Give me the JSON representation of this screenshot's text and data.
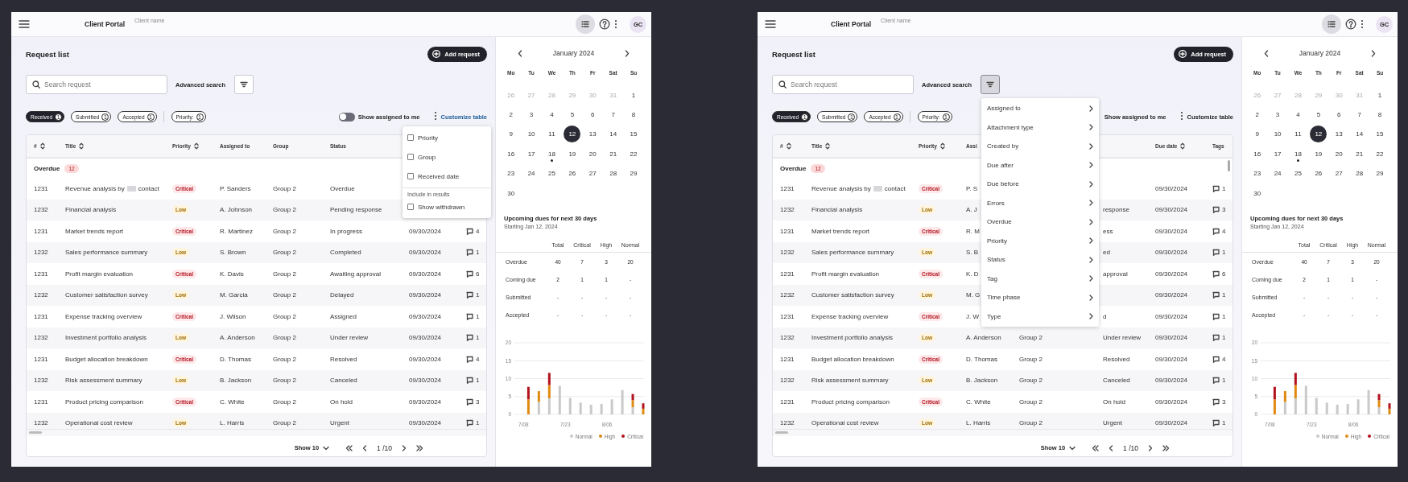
{
  "screens": [
    {
      "header": {
        "app_title": "Client Portal",
        "client_label": "Client name",
        "avatar": "GC"
      },
      "page_title": "Request list",
      "add_button": "Add request",
      "search": {
        "placeholder": "Search request"
      },
      "advanced_search": "Advanced search",
      "filter_button": {
        "active": false
      },
      "chips": [
        {
          "label": "Received",
          "count": "1",
          "selected": true
        },
        {
          "label": "Submitted",
          "count": "1",
          "selected": false
        },
        {
          "label": "Accepted",
          "count": "1",
          "selected": false
        },
        {
          "label": "Priority:",
          "count": "1",
          "selected": false
        }
      ],
      "assigned_toggle": {
        "label": "Show assigned to me",
        "on": false
      },
      "customize": {
        "label": "Customize table",
        "active": true
      },
      "table": {
        "columns": [
          {
            "label": "#",
            "sortable": true
          },
          {
            "label": "Title",
            "sortable": true
          },
          {
            "label": "Priority",
            "sortable": true
          },
          {
            "label": "Assigned to",
            "sortable": false
          },
          {
            "label": "Group",
            "sortable": false
          },
          {
            "label": "Status",
            "sortable": false
          },
          null,
          null
        ],
        "group": {
          "label": "Overdue",
          "count": "12"
        },
        "rows": [
          {
            "id": "1231",
            "title": "Revenue analysis by",
            "title_end": "contact",
            "priority": {
              "label": "Critical",
              "kind": "critical"
            },
            "assigned_to": "P. Sanders",
            "group": "Group 2",
            "status": "Overdue"
          },
          {
            "id": "1232",
            "title": "Financial analysis",
            "priority": {
              "label": "Low",
              "kind": "low"
            },
            "assigned_to": "A. Johnson",
            "group": "Group 2",
            "status": "Pending response"
          },
          {
            "id": "1231",
            "title": "Market trends report",
            "priority": {
              "label": "Critical",
              "kind": "critical"
            },
            "assigned_to": "R. Martinez",
            "group": "Group 2",
            "status": "In progress",
            "due_date": "09/30/2024",
            "tags": "4"
          },
          {
            "id": "1232",
            "title": "Sales performance summary",
            "priority": {
              "label": "Low",
              "kind": "low"
            },
            "assigned_to": "S. Brown",
            "group": "Group 2",
            "status": "Completed",
            "due_date": "09/30/2024",
            "tags": "1"
          },
          {
            "id": "1231",
            "title": "Profit margin evaluation",
            "priority": {
              "label": "Critical",
              "kind": "critical"
            },
            "assigned_to": "K. Davis",
            "group": "Group 2",
            "status": "Awaiting approval",
            "due_date": "09/30/2024",
            "tags": "6"
          },
          {
            "id": "1232",
            "title": "Customer satisfaction survey",
            "priority": {
              "label": "Low",
              "kind": "low"
            },
            "assigned_to": "M. Garcia",
            "group": "Group 2",
            "status": "Delayed",
            "due_date": "09/30/2024",
            "tags": "1"
          },
          {
            "id": "1231",
            "title": "Expense tracking overview",
            "priority": {
              "label": "Critical",
              "kind": "critical"
            },
            "assigned_to": "J. Wilson",
            "group": "Group 2",
            "status": "Assigned",
            "due_date": "09/30/2024",
            "tags": "1"
          },
          {
            "id": "1232",
            "title": "Investment portfolio analysis",
            "priority": {
              "label": "Low",
              "kind": "low"
            },
            "assigned_to": "A. Anderson",
            "group": "Group 2",
            "status": "Under review",
            "due_date": "09/30/2024",
            "tags": "1"
          },
          {
            "id": "1231",
            "title": "Budget allocation breakdown",
            "priority": {
              "label": "Critical",
              "kind": "critical"
            },
            "assigned_to": "D. Thomas",
            "group": "Group 2",
            "status": "Resolved",
            "due_date": "09/30/2024",
            "tags": "4"
          },
          {
            "id": "1232",
            "title": "Risk assessment summary",
            "priority": {
              "label": "Low",
              "kind": "low"
            },
            "assigned_to": "B. Jackson",
            "group": "Group 2",
            "status": "Canceled",
            "due_date": "09/30/2024",
            "tags": "1"
          },
          {
            "id": "1231",
            "title": "Product pricing comparison",
            "priority": {
              "label": "Critical",
              "kind": "critical"
            },
            "assigned_to": "C. White",
            "group": "Group 2",
            "status": "On hold",
            "due_date": "09/30/2024",
            "tags": "3"
          },
          {
            "id": "1232",
            "title": "Operational cost review",
            "priority": {
              "label": "Low",
              "kind": "low"
            },
            "assigned_to": "L. Harris",
            "group": "Group 2",
            "status": "Urgent",
            "due_date": "09/30/2024",
            "tags": "1"
          }
        ]
      },
      "pagination": {
        "page_size": "Show 10",
        "page": "1 /10"
      },
      "customize_menu": {
        "items": [
          {
            "label": "Priority",
            "checked": false
          },
          {
            "label": "Group",
            "checked": false
          },
          {
            "label": "Received date",
            "checked": false
          }
        ],
        "section": "Include in results",
        "section_items": [
          {
            "label": "Show withdrawn",
            "checked": false
          }
        ]
      },
      "calendar": {
        "month": "January 2024",
        "weekdays": [
          "Mo",
          "Tu",
          "We",
          "Th",
          "Fr",
          "Sat",
          "Su"
        ],
        "days": [
          {
            "label": "26",
            "outside": true,
            "selected": false,
            "event": false
          },
          {
            "label": "27",
            "outside": true,
            "selected": false,
            "event": false
          },
          {
            "label": "28",
            "outside": true,
            "selected": false,
            "event": false
          },
          {
            "label": "29",
            "outside": true,
            "selected": false,
            "event": false
          },
          {
            "label": "30",
            "outside": true,
            "selected": false,
            "event": false
          },
          {
            "label": "31",
            "outside": true,
            "selected": false,
            "event": false
          },
          {
            "label": "1",
            "outside": false,
            "selected": false,
            "event": false
          },
          {
            "label": "2",
            "outside": false,
            "selected": false,
            "event": false
          },
          {
            "label": "3",
            "outside": false,
            "selected": false,
            "event": false
          },
          {
            "label": "4",
            "outside": false,
            "selected": false,
            "event": false
          },
          {
            "label": "5",
            "outside": false,
            "selected": false,
            "event": false
          },
          {
            "label": "6",
            "outside": false,
            "selected": false,
            "event": false
          },
          {
            "label": "7",
            "outside": false,
            "selected": false,
            "event": false
          },
          {
            "label": "8",
            "outside": false,
            "selected": false,
            "event": false
          },
          {
            "label": "9",
            "outside": false,
            "selected": false,
            "event": false
          },
          {
            "label": "10",
            "outside": false,
            "selected": false,
            "event": false
          },
          {
            "label": "11",
            "outside": false,
            "selected": false,
            "event": false
          },
          {
            "label": "12",
            "outside": false,
            "selected": true,
            "event": false
          },
          {
            "label": "13",
            "outside": false,
            "selected": false,
            "event": false
          },
          {
            "label": "14",
            "outside": false,
            "selected": false,
            "event": false
          },
          {
            "label": "15",
            "outside": false,
            "selected": false,
            "event": false
          },
          {
            "label": "16",
            "outside": false,
            "selected": false,
            "event": false
          },
          {
            "label": "17",
            "outside": false,
            "selected": false,
            "event": false
          },
          {
            "label": "18",
            "outside": false,
            "selected": false,
            "event": true
          },
          {
            "label": "19",
            "outside": false,
            "selected": false,
            "event": false
          },
          {
            "label": "20",
            "outside": false,
            "selected": false,
            "event": false
          },
          {
            "label": "21",
            "outside": false,
            "selected": false,
            "event": false
          },
          {
            "label": "22",
            "outside": false,
            "selected": false,
            "event": false
          },
          {
            "label": "23",
            "outside": false,
            "selected": false,
            "event": false
          },
          {
            "label": "24",
            "outside": false,
            "selected": false,
            "event": false
          },
          {
            "label": "25",
            "outside": false,
            "selected": false,
            "event": false
          },
          {
            "label": "26",
            "outside": false,
            "selected": false,
            "event": false
          },
          {
            "label": "27",
            "outside": false,
            "selected": false,
            "event": false
          },
          {
            "label": "28",
            "outside": false,
            "selected": false,
            "event": false
          },
          {
            "label": "29",
            "outside": false,
            "selected": false,
            "event": false
          },
          {
            "label": "30",
            "outside": false,
            "selected": false,
            "event": false
          }
        ]
      },
      "dues": {
        "title": "Upcoming dues for next 30 days",
        "subtitle": "Starting Jan 12, 2024",
        "columns": [
          "Total",
          "Critical",
          "High",
          "Normal"
        ],
        "rows": [
          {
            "label": "Overdue",
            "values": [
              "40",
              "7",
              "3",
              "20"
            ]
          },
          {
            "label": "Coming due",
            "values": [
              "2",
              "1",
              "1",
              "-"
            ]
          },
          {
            "label": "Submitted",
            "values": [
              "-",
              "-",
              "-",
              "-"
            ]
          },
          {
            "label": "Accepted",
            "values": [
              "-",
              "-",
              "-",
              "-"
            ]
          }
        ]
      },
      "chart_data": {
        "type": "bar",
        "stacked": true,
        "grid": true,
        "categories": [
          "7/08",
          null,
          null,
          null,
          "7/23",
          null,
          null,
          null,
          "8/06",
          null,
          null,
          null
        ],
        "ylim": [
          0,
          20
        ],
        "yticks": [
          0,
          5,
          10,
          15,
          20
        ],
        "series": [
          {
            "name": "Normal",
            "color": "#c9c9cc",
            "values": [
              0,
              3.5,
              4.5,
              8,
              4.6,
              3.3,
              2.7,
              2.9,
              4.2,
              6.8,
              2,
              0
            ]
          },
          {
            "name": "High",
            "color": "#e08a12",
            "values": [
              4.2,
              3,
              3.7,
              0,
              0,
              0,
              0,
              0,
              0,
              0,
              2,
              1.6
            ]
          },
          {
            "name": "Critical",
            "color": "#b3121f",
            "values": [
              3.5,
              0,
              3.4,
              0,
              0,
              0,
              0,
              0,
              0,
              0,
              1.7,
              1.5
            ]
          }
        ]
      }
    },
    {
      "header": {
        "app_title": "Client Portal",
        "client_label": "Client name",
        "avatar": "GC"
      },
      "page_title": "Request list",
      "add_button": "Add request",
      "search": {
        "placeholder": "Search request"
      },
      "advanced_search": "Advanced search",
      "filter_button": {
        "active": true
      },
      "chips": [
        {
          "label": "Received",
          "count": "1",
          "selected": true
        },
        {
          "label": "Submitted",
          "count": "1",
          "selected": false
        },
        {
          "label": "Accepted",
          "count": "1",
          "selected": false
        },
        {
          "label": "Priority:",
          "count": "1",
          "selected": false
        }
      ],
      "assigned_toggle": {
        "label": "Show assigned to me"
      },
      "customize": {
        "label": "Customize table",
        "active": false
      },
      "table": {
        "columns": [
          {
            "label": "#",
            "sortable": true
          },
          {
            "label": "Title",
            "sortable": true
          },
          {
            "label": "Priority",
            "sortable": true
          },
          {
            "label": "Assi",
            "sortable": false
          },
          null,
          null,
          {
            "label": "Due date",
            "sortable": true
          },
          {
            "label": "Tags",
            "sortable": false
          }
        ],
        "group": {
          "label": "Overdue",
          "count": "12"
        },
        "rows": [
          {
            "id": "1231",
            "title": "Revenue analysis by",
            "title_end": "contact",
            "priority": {
              "label": "Critical",
              "kind": "critical"
            },
            "assigned_to": "P. S",
            "due_date": "09/30/2024",
            "tags": "1"
          },
          {
            "id": "1232",
            "title": "Financial analysis",
            "priority": {
              "label": "Low",
              "kind": "low"
            },
            "assigned_to": "A. J",
            "status": "response",
            "due_date": "09/30/2024",
            "tags": "3"
          },
          {
            "id": "1231",
            "title": "Market trends report",
            "priority": {
              "label": "Critical",
              "kind": "critical"
            },
            "assigned_to": "R. M",
            "status": "ess",
            "due_date": "09/30/2024",
            "tags": "4"
          },
          {
            "id": "1232",
            "title": "Sales performance summary",
            "priority": {
              "label": "Low",
              "kind": "low"
            },
            "assigned_to": "S. B",
            "status": "ed",
            "due_date": "09/30/2024",
            "tags": "1"
          },
          {
            "id": "1231",
            "title": "Profit margin evaluation",
            "priority": {
              "label": "Critical",
              "kind": "critical"
            },
            "assigned_to": "K. D",
            "status": "approval",
            "due_date": "09/30/2024",
            "tags": "6"
          },
          {
            "id": "1232",
            "title": "Customer satisfaction survey",
            "priority": {
              "label": "Low",
              "kind": "low"
            },
            "assigned_to": "M. G",
            "due_date": "09/30/2024",
            "tags": "1"
          },
          {
            "id": "1231",
            "title": "Expense tracking overview",
            "priority": {
              "label": "Critical",
              "kind": "critical"
            },
            "assigned_to": "J. W",
            "status": "d",
            "due_date": "09/30/2024",
            "tags": "1"
          },
          {
            "id": "1232",
            "title": "Investment portfolio analysis",
            "priority": {
              "label": "Low",
              "kind": "low"
            },
            "assigned_to": "A. Anderson",
            "group": "Group 2",
            "status": "Under review",
            "due_date": "09/30/2024",
            "tags": "1"
          },
          {
            "id": "1231",
            "title": "Budget allocation breakdown",
            "priority": {
              "label": "Critical",
              "kind": "critical"
            },
            "assigned_to": "D. Thomas",
            "group": "Group 2",
            "status": "Resolved",
            "due_date": "09/30/2024",
            "tags": "4"
          },
          {
            "id": "1232",
            "title": "Risk assessment summary",
            "priority": {
              "label": "Low",
              "kind": "low"
            },
            "assigned_to": "B. Jackson",
            "group": "Group 2",
            "status": "Canceled",
            "due_date": "09/30/2024",
            "tags": "1"
          },
          {
            "id": "1231",
            "title": "Product pricing comparison",
            "priority": {
              "label": "Critical",
              "kind": "critical"
            },
            "assigned_to": "C. White",
            "group": "Group 2",
            "status": "On hold",
            "due_date": "09/30/2024",
            "tags": "3"
          },
          {
            "id": "1232",
            "title": "Operational cost review",
            "priority": {
              "label": "Low",
              "kind": "low"
            },
            "assigned_to": "L. Harris",
            "group": "Group 2",
            "status": "Urgent",
            "due_date": "09/30/2024",
            "tags": "1"
          }
        ]
      },
      "pagination": {
        "page_size": "Show 10",
        "page": "1 /10"
      },
      "filter_menu": {
        "items": [
          "Assigned to",
          "Attachment type",
          "Created by",
          "Due after",
          "Due before",
          "Errors",
          "Overdue",
          "Priority",
          "Status",
          "Tag",
          "Time phase",
          "Type"
        ]
      },
      "calendar": {
        "month": "January 2024",
        "weekdays": [
          "Mo",
          "Tu",
          "We",
          "Th",
          "Fr",
          "Sat",
          "Su"
        ],
        "days": [
          {
            "label": "26",
            "outside": true,
            "selected": false,
            "event": false
          },
          {
            "label": "27",
            "outside": true,
            "selected": false,
            "event": false
          },
          {
            "label": "28",
            "outside": true,
            "selected": false,
            "event": false
          },
          {
            "label": "29",
            "outside": true,
            "selected": false,
            "event": false
          },
          {
            "label": "30",
            "outside": true,
            "selected": false,
            "event": false
          },
          {
            "label": "31",
            "outside": true,
            "selected": false,
            "event": false
          },
          {
            "label": "1",
            "outside": false,
            "selected": false,
            "event": false
          },
          {
            "label": "2",
            "outside": false,
            "selected": false,
            "event": false
          },
          {
            "label": "3",
            "outside": false,
            "selected": false,
            "event": false
          },
          {
            "label": "4",
            "outside": false,
            "selected": false,
            "event": false
          },
          {
            "label": "5",
            "outside": false,
            "selected": false,
            "event": false
          },
          {
            "label": "6",
            "outside": false,
            "selected": false,
            "event": false
          },
          {
            "label": "7",
            "outside": false,
            "selected": false,
            "event": false
          },
          {
            "label": "8",
            "outside": false,
            "selected": false,
            "event": false
          },
          {
            "label": "9",
            "outside": false,
            "selected": false,
            "event": false
          },
          {
            "label": "10",
            "outside": false,
            "selected": false,
            "event": false
          },
          {
            "label": "11",
            "outside": false,
            "selected": false,
            "event": false
          },
          {
            "label": "12",
            "outside": false,
            "selected": true,
            "event": false
          },
          {
            "label": "13",
            "outside": false,
            "selected": false,
            "event": false
          },
          {
            "label": "14",
            "outside": false,
            "selected": false,
            "event": false
          },
          {
            "label": "15",
            "outside": false,
            "selected": false,
            "event": false
          },
          {
            "label": "16",
            "outside": false,
            "selected": false,
            "event": false
          },
          {
            "label": "17",
            "outside": false,
            "selected": false,
            "event": false
          },
          {
            "label": "18",
            "outside": false,
            "selected": false,
            "event": true
          },
          {
            "label": "19",
            "outside": false,
            "selected": false,
            "event": false
          },
          {
            "label": "20",
            "outside": false,
            "selected": false,
            "event": false
          },
          {
            "label": "21",
            "outside": false,
            "selected": false,
            "event": false
          },
          {
            "label": "22",
            "outside": false,
            "selected": false,
            "event": false
          },
          {
            "label": "23",
            "outside": false,
            "selected": false,
            "event": false
          },
          {
            "label": "24",
            "outside": false,
            "selected": false,
            "event": false
          },
          {
            "label": "25",
            "outside": false,
            "selected": false,
            "event": false
          },
          {
            "label": "26",
            "outside": false,
            "selected": false,
            "event": false
          },
          {
            "label": "27",
            "outside": false,
            "selected": false,
            "event": false
          },
          {
            "label": "28",
            "outside": false,
            "selected": false,
            "event": false
          },
          {
            "label": "29",
            "outside": false,
            "selected": false,
            "event": false
          },
          {
            "label": "30",
            "outside": false,
            "selected": false,
            "event": false
          }
        ]
      },
      "dues": {
        "title": "Upcoming dues for next 30 days",
        "subtitle": "Starting Jan 12, 2024",
        "columns": [
          "Total",
          "Critical",
          "High",
          "Normal"
        ],
        "rows": [
          {
            "label": "Overdue",
            "values": [
              "40",
              "7",
              "3",
              "20"
            ]
          },
          {
            "label": "Coming due",
            "values": [
              "2",
              "1",
              "1",
              "-"
            ]
          },
          {
            "label": "Submitted",
            "values": [
              "-",
              "-",
              "-",
              "-"
            ]
          },
          {
            "label": "Accepted",
            "values": [
              "-",
              "-",
              "-",
              "-"
            ]
          }
        ]
      },
      "chart_data": {
        "type": "bar",
        "stacked": true,
        "grid": true,
        "categories": [
          "7/08",
          null,
          null,
          null,
          "7/23",
          null,
          null,
          null,
          "8/06",
          null,
          null,
          null
        ],
        "ylim": [
          0,
          20
        ],
        "yticks": [
          0,
          5,
          10,
          15,
          20
        ],
        "series": [
          {
            "name": "Normal",
            "color": "#c9c9cc",
            "values": [
              0,
              3.5,
              4.5,
              8,
              4.6,
              3.3,
              2.7,
              2.9,
              4.2,
              6.8,
              2,
              0
            ]
          },
          {
            "name": "High",
            "color": "#e08a12",
            "values": [
              4.2,
              3,
              3.7,
              0,
              0,
              0,
              0,
              0,
              0,
              0,
              2,
              1.6
            ]
          },
          {
            "name": "Critical",
            "color": "#b3121f",
            "values": [
              3.5,
              0,
              3.4,
              0,
              0,
              0,
              0,
              0,
              0,
              0,
              1.7,
              1.5
            ]
          }
        ]
      }
    }
  ]
}
